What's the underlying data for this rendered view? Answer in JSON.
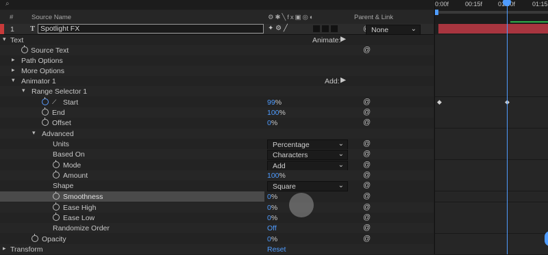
{
  "header": {
    "hash": "#",
    "source_name": "Source Name",
    "parent_link": "Parent & Link"
  },
  "layer": {
    "number": "1",
    "type_icon": "T",
    "name": "Spotlight FX",
    "parent": "None"
  },
  "timeline": {
    "t0": "0:00f",
    "t1": "00:15f",
    "t2": "01:00f",
    "t3": "01:15"
  },
  "props": {
    "text": "Text",
    "animate": "Animate:",
    "source_text": "Source Text",
    "path_options": "Path Options",
    "more_options": "More Options",
    "animator": "Animator 1",
    "add": "Add:",
    "range_selector": "Range Selector 1",
    "start": "Start",
    "start_val": "99",
    "end": "End",
    "end_val": "100",
    "offset": "Offset",
    "offset_val": "0",
    "advanced": "Advanced",
    "units": "Units",
    "units_val": "Percentage",
    "based_on": "Based On",
    "based_on_val": "Characters",
    "mode": "Mode",
    "mode_val": "Add",
    "amount": "Amount",
    "amount_val": "100",
    "shape": "Shape",
    "shape_val": "Square",
    "smoothness": "Smoothness",
    "smoothness_val": "0",
    "ease_high": "Ease High",
    "ease_high_val": "0",
    "ease_low": "Ease Low",
    "ease_low_val": "0",
    "randomize": "Randomize Order",
    "randomize_val": "Off",
    "opacity": "Opacity",
    "opacity_val": "0",
    "transform": "Transform",
    "reset": "Reset",
    "percent": "%"
  }
}
